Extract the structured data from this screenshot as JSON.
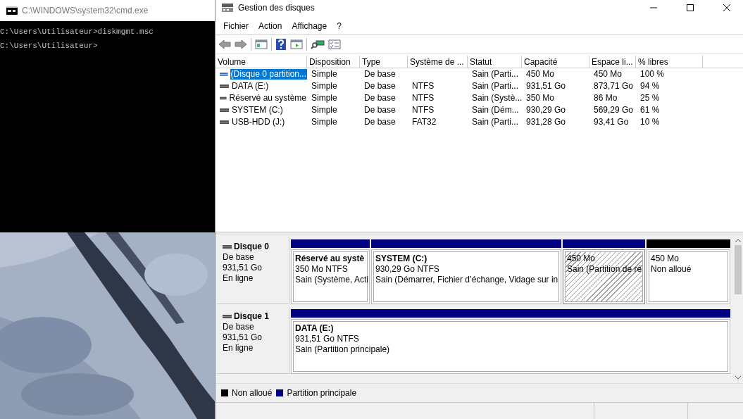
{
  "console": {
    "title": "C:\\WINDOWS\\system32\\cmd.exe",
    "lines": [
      "C:\\Users\\Utilisateur>diskmgmt.msc",
      "C:\\Users\\Utilisateur>"
    ]
  },
  "window": {
    "title": "Gestion des disques"
  },
  "menu": [
    "Fichier",
    "Action",
    "Affichage",
    "?"
  ],
  "table": {
    "columns": [
      "Volume",
      "Disposition",
      "Type",
      "Système de ...",
      "Statut",
      "Capacité",
      "Espace li...",
      "% libres"
    ],
    "rows": [
      {
        "selected": true,
        "cells": [
          "(Disque 0 partition...",
          "Simple",
          "De base",
          "",
          "Sain (Parti...",
          "450 Mo",
          "450 Mo",
          "100 %"
        ]
      },
      {
        "selected": false,
        "cells": [
          "DATA (E:)",
          "Simple",
          "De base",
          "NTFS",
          "Sain (Parti...",
          "931,51 Go",
          "873,71 Go",
          "94 %"
        ]
      },
      {
        "selected": false,
        "cells": [
          "Réservé au système",
          "Simple",
          "De base",
          "NTFS",
          "Sain (Systè...",
          "350 Mo",
          "86 Mo",
          "25 %"
        ]
      },
      {
        "selected": false,
        "cells": [
          "SYSTEM (C:)",
          "Simple",
          "De base",
          "NTFS",
          "Sain (Dém...",
          "930,29 Go",
          "569,29 Go",
          "61 %"
        ]
      },
      {
        "selected": false,
        "cells": [
          "USB-HDD (J:)",
          "Simple",
          "De base",
          "FAT32",
          "Sain (Parti...",
          "931,28 Go",
          "93,41 Go",
          "10 %"
        ]
      }
    ]
  },
  "disks": [
    {
      "name": "Disque 0",
      "type": "De base",
      "size": "931,51 Go",
      "status": "En ligne",
      "partitions": [
        {
          "name": "Réservé au systè",
          "size": "350 Mo NTFS",
          "status": "Sain (Système, Acti",
          "color": "#000080",
          "selected": false
        },
        {
          "name": "SYSTEM  (C:)",
          "size": "930,29 Go NTFS",
          "status": "Sain (Démarrer, Fichier d’échange, Vidage sur in",
          "color": "#000080",
          "selected": false
        },
        {
          "size": "450 Mo",
          "status": "Sain (Partition de ré",
          "color": "#000080",
          "selected": true
        },
        {
          "size": "450 Mo",
          "status": "Non alloué",
          "color": "#000000",
          "selected": false
        }
      ]
    },
    {
      "name": "Disque 1",
      "type": "De base",
      "size": "931,51 Go",
      "status": "En ligne",
      "partitions": [
        {
          "name": "DATA  (E:)",
          "size": "931,51 Go NTFS",
          "status": "Sain (Partition principale)",
          "color": "#000080",
          "selected": false
        }
      ]
    }
  ],
  "legend": [
    {
      "label": "Non alloué",
      "color": "#000000"
    },
    {
      "label": "Partition principale",
      "color": "#000080"
    }
  ]
}
